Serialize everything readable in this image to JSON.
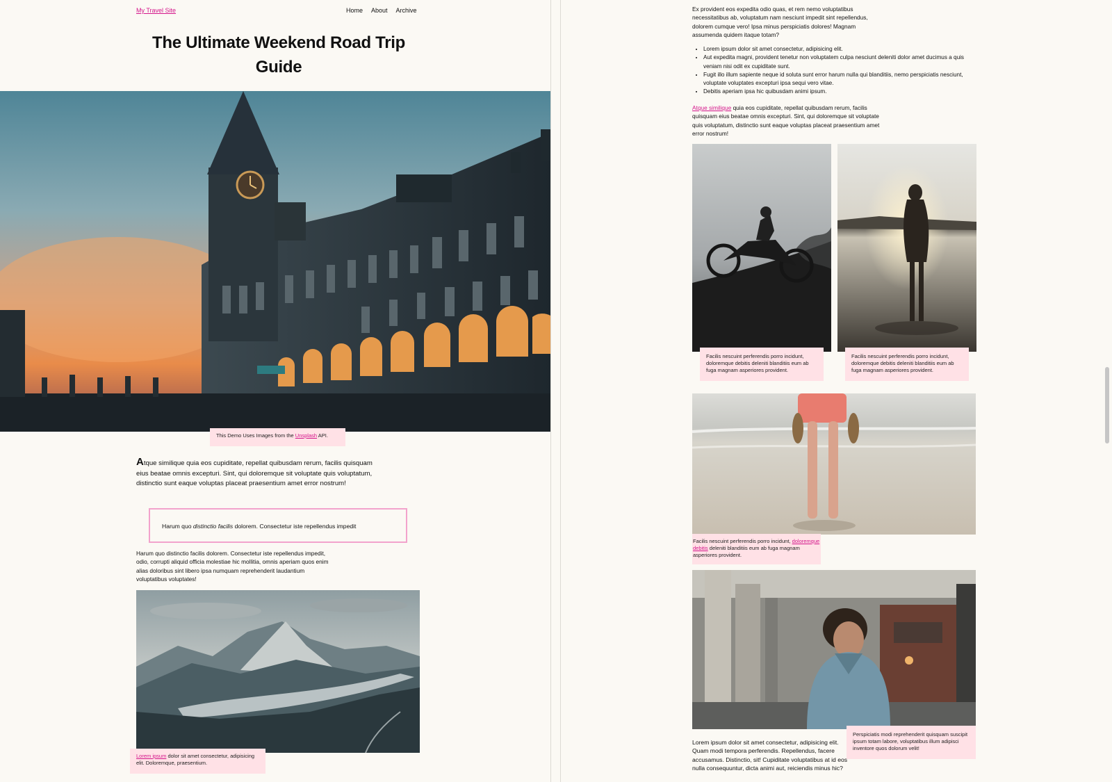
{
  "site": {
    "name": "My Travel Site"
  },
  "nav": [
    "Home",
    "About",
    "Archive"
  ],
  "article": {
    "title": "The Ultimate Weekend Road Trip Guide",
    "hero_caption_prefix": "This Demo Uses Images from the ",
    "hero_caption_link": "Unsplash",
    "hero_caption_suffix": " API.",
    "intro_dropcap": "A",
    "intro_rest": "tque similique quia eos cupiditate, repellat quibusdam rerum, facilis quisquam eius beatae omnis excepturi. Sint, qui doloremque sit voluptate quis voluptatum, distinctio sunt eaque voluptas placeat praesentium amet error nostrum!",
    "quote_before": "Harum quo ",
    "quote_em": "distinctio facilis",
    "quote_after": " dolorem. Consectetur iste repellendus impedit",
    "paragraph_2": "Harum quo distinctio facilis dolorem. Consectetur iste repellendus impedit, odio, corrupti aliquid officia molestiae hic mollitia, omnis aperiam quos enim alias doloribus sint libero ipsa numquam reprehenderit laudantium voluptatibus voluptates!",
    "mountain_caption_link": "Lorem ipsum",
    "mountain_caption_rest": " dolor sit amet consectetur, adipisicing elit. Doloremque, praesentium."
  },
  "right_pane": {
    "top_paragraph": "Ex provident eos expedita odio quas, et rem nemo voluptatibus necessitatibus ab, voluptatum nam nesciunt impedit sint repellendus, dolorem cumque vero! Ipsa minus perspiciatis dolores! Magnam assumenda quidem itaque totam?",
    "bullets": [
      "Lorem ipsum dolor sit amet consectetur, adipisicing elit.",
      "Aut expedita magni, provident tenetur non voluptatem culpa nesciunt deleniti dolor amet ducimus a quis veniam nisi odit ex cupiditate sunt.",
      "Fugit illo illum sapiente neque id soluta sunt error harum nulla qui blanditiis, nemo perspiciatis nesciunt, voluptate voluptates excepturi ipsa sequi vero vitae.",
      "Debitis aperiam ipsa hic quibusdam animi ipsum."
    ],
    "link_para_link": "Atque similique",
    "link_para_rest": " quia eos cupiditate, repellat quibusdam rerum, facilis quisquam eius beatae omnis excepturi. Sint, qui doloremque sit voluptate quis voluptatum, distinctio sunt eaque voluptas placeat praesentium amet error nostrum!",
    "moto_caption": "Facilis nescuint perferendis porro incidunt, doloremque debitis deleniti blanditiis eum ab fuga magnam asperiores provident.",
    "water_caption": "Facilis nescuint perferendis porro incidunt, doloremque debitis deleniti blanditiis eum ab fuga magnam asperiores provident.",
    "beach_caption_before": "Facilis nescuint perferendis porro incidunt, ",
    "beach_caption_link": "doloremque debitis",
    "beach_caption_after": " deleniti blanditiis eum ab fuga magnam asperiores provident.",
    "street_caption": "Perspiciatis modi reprehenderit quisquam suscipit ipsum totam labore, voluptatibus illum adipisci inventore quos dolorum velit!",
    "bottom_paragraph": "Lorem ipsum dolor sit amet consectetur, adipisicing elit. Quam modi tempora perferendis. Repellendus, facere accusamus. Distinctio, sit! Cupiditate voluptatibus at id eos nulla consequuntur, dicta animi aut, reiciendis minus hic?"
  },
  "colors": {
    "background": "#fbf9f4",
    "accent_link": "#d4148a",
    "caption_bg": "#ffe1e6",
    "quote_border": "#f2a3cc"
  },
  "icons": {
    "scrollbar": "scrollbar-thumb"
  }
}
